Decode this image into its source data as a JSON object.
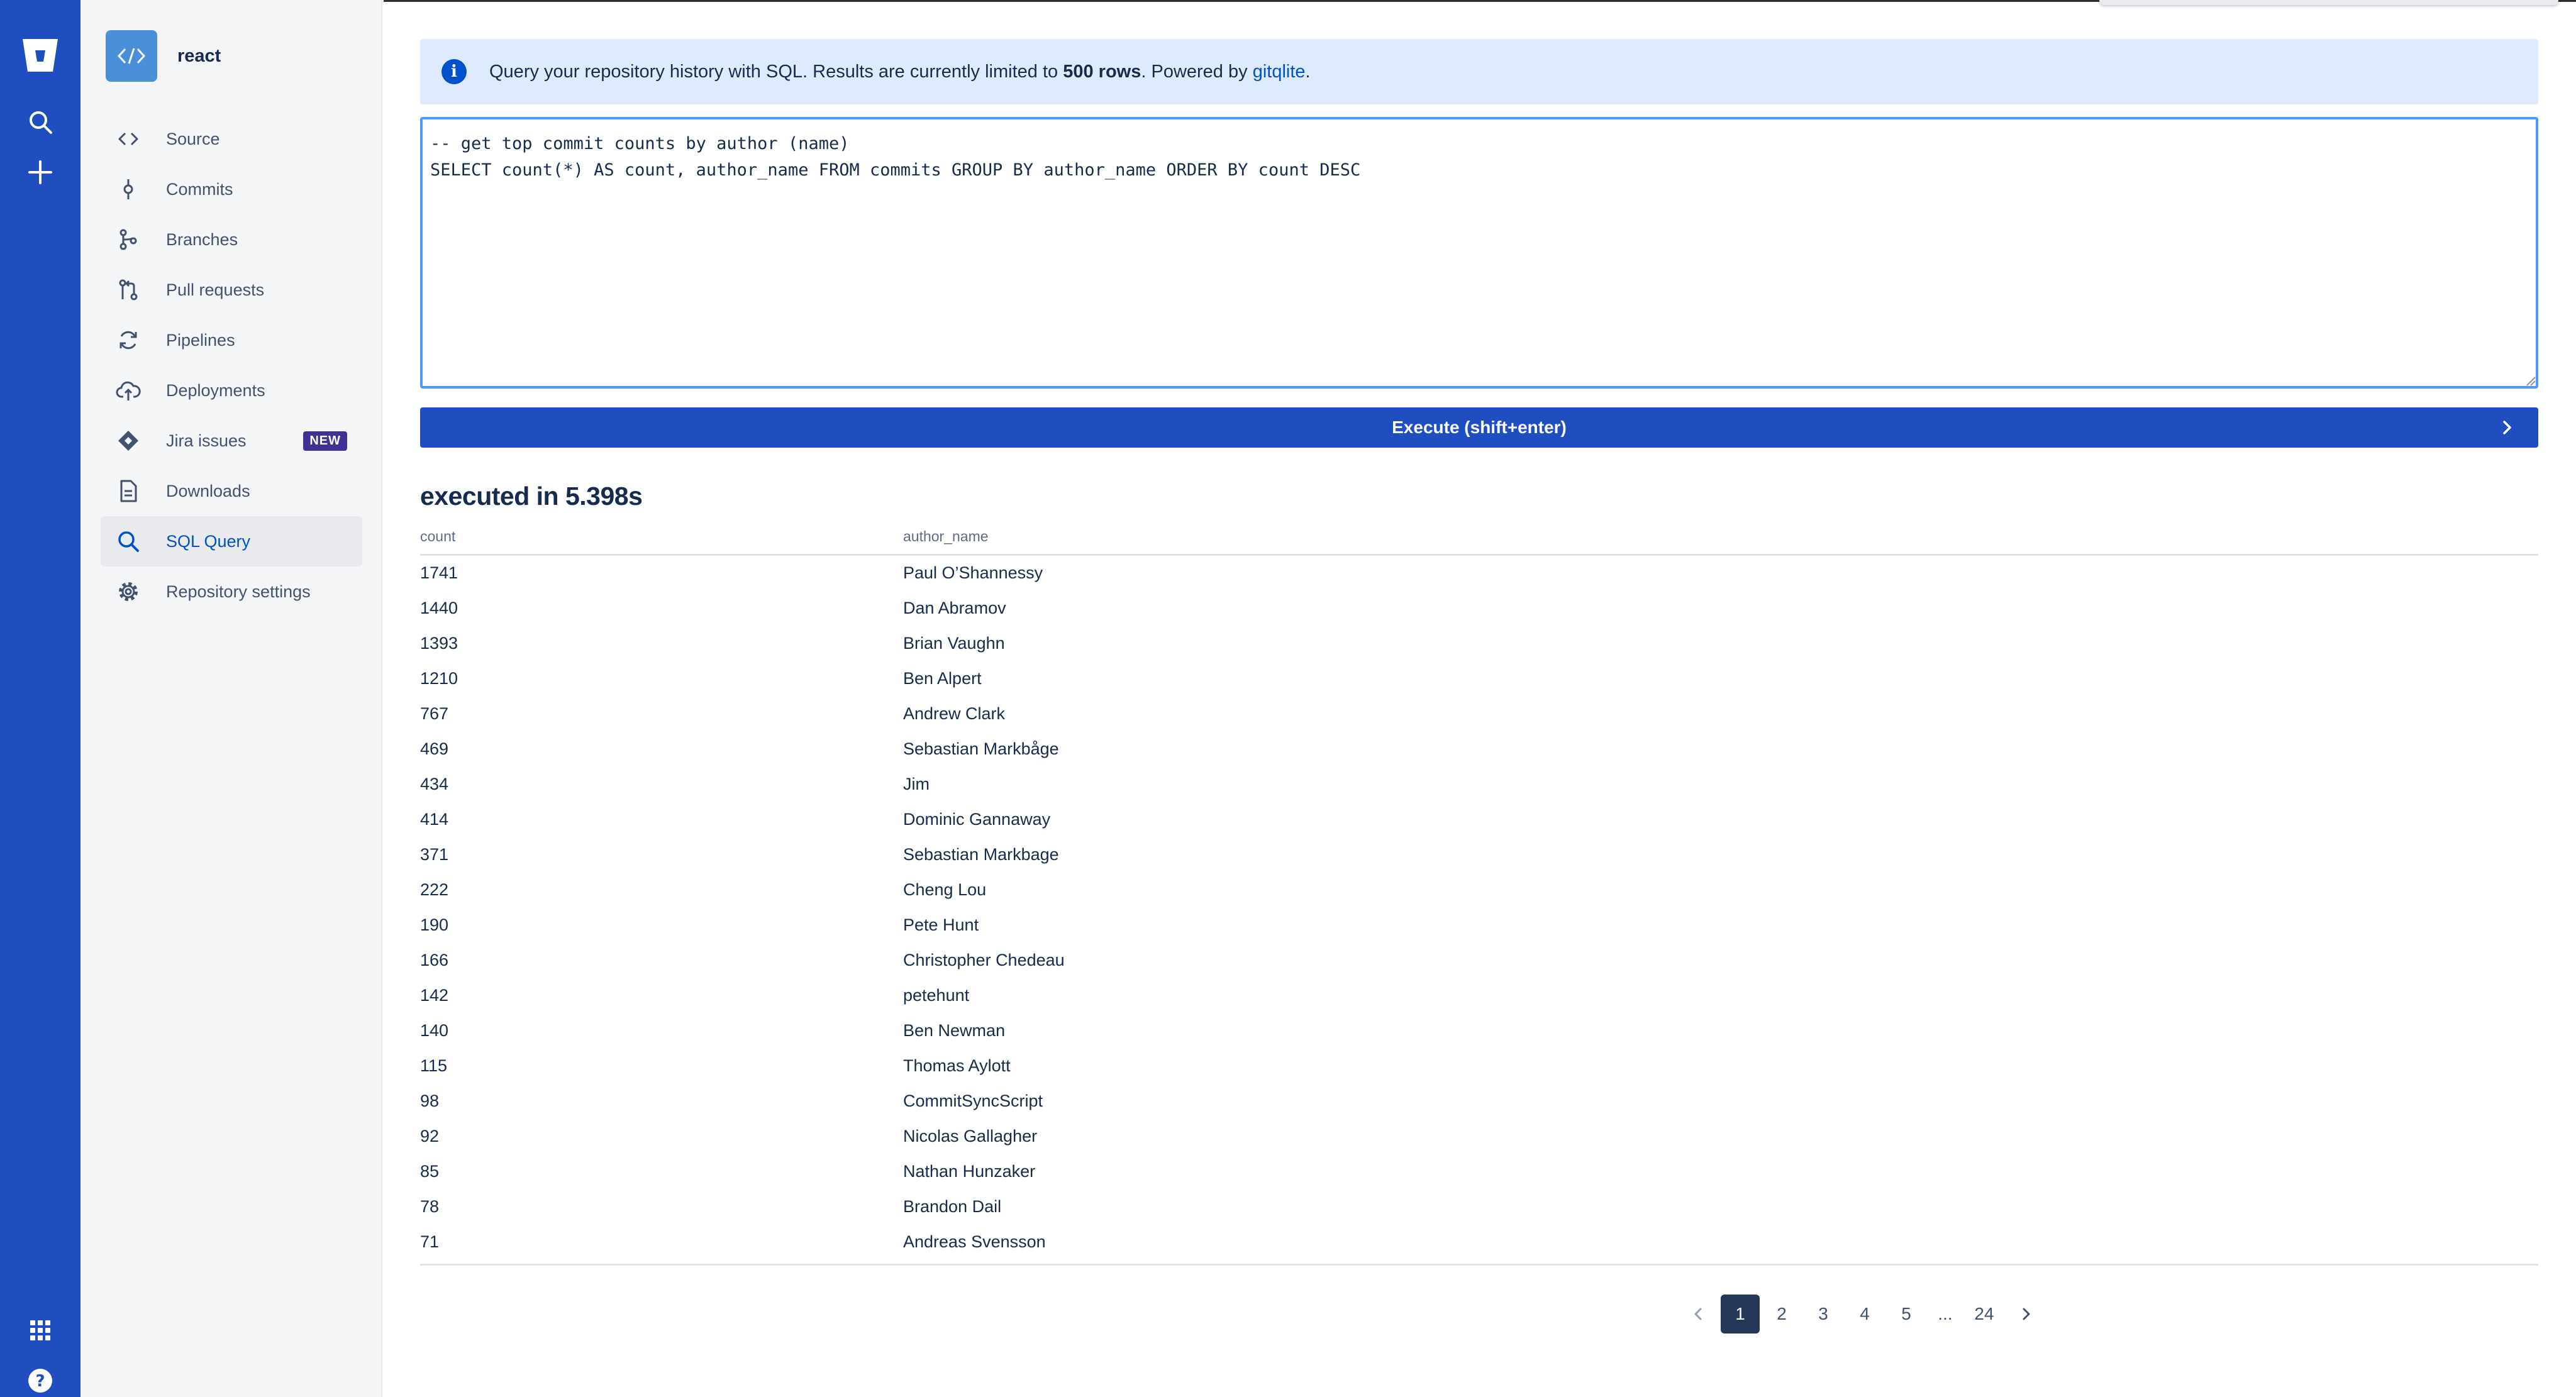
{
  "global_nav": {
    "icons": [
      "bitbucket-logo-icon",
      "search-icon",
      "create-plus-icon",
      "app-switcher-icon",
      "help-icon"
    ]
  },
  "sidebar": {
    "repo_name": "react",
    "items": [
      {
        "label": "Source",
        "icon": "code-icon",
        "active": false
      },
      {
        "label": "Commits",
        "icon": "commit-icon",
        "active": false
      },
      {
        "label": "Branches",
        "icon": "branch-icon",
        "active": false
      },
      {
        "label": "Pull requests",
        "icon": "pull-request-icon",
        "active": false
      },
      {
        "label": "Pipelines",
        "icon": "pipelines-icon",
        "active": false
      },
      {
        "label": "Deployments",
        "icon": "cloud-upload-icon",
        "active": false
      },
      {
        "label": "Jira issues",
        "icon": "jira-icon",
        "active": false,
        "badge": "NEW"
      },
      {
        "label": "Downloads",
        "icon": "document-icon",
        "active": false
      },
      {
        "label": "SQL Query",
        "icon": "search-icon",
        "active": true
      },
      {
        "label": "Repository settings",
        "icon": "gear-icon",
        "active": false
      }
    ]
  },
  "banner": {
    "text_before": "Query your repository history with SQL. Results are currently limited to ",
    "bold": "500 rows",
    "text_middle": ". Powered by ",
    "link": "gitqlite",
    "text_after": "."
  },
  "editor": {
    "value": "-- get top commit counts by author (name)\nSELECT count(*) AS count, author_name FROM commits GROUP BY author_name ORDER BY count DESC"
  },
  "execute_button": {
    "label": "Execute (shift+enter)"
  },
  "exec_time": "executed in 5.398s",
  "results": {
    "columns": [
      "count",
      "author_name"
    ],
    "rows": [
      [
        "1741",
        "Paul O’Shannessy"
      ],
      [
        "1440",
        "Dan Abramov"
      ],
      [
        "1393",
        "Brian Vaughn"
      ],
      [
        "1210",
        "Ben Alpert"
      ],
      [
        "767",
        "Andrew Clark"
      ],
      [
        "469",
        "Sebastian Markbåge"
      ],
      [
        "434",
        "Jim"
      ],
      [
        "414",
        "Dominic Gannaway"
      ],
      [
        "371",
        "Sebastian Markbage"
      ],
      [
        "222",
        "Cheng Lou"
      ],
      [
        "190",
        "Pete Hunt"
      ],
      [
        "166",
        "Christopher Chedeau"
      ],
      [
        "142",
        "petehunt"
      ],
      [
        "140",
        "Ben Newman"
      ],
      [
        "115",
        "Thomas Aylott"
      ],
      [
        "98",
        "CommitSyncScript"
      ],
      [
        "92",
        "Nicolas Gallagher"
      ],
      [
        "85",
        "Nathan Hunzaker"
      ],
      [
        "78",
        "Brandon Dail"
      ],
      [
        "71",
        "Andreas Svensson"
      ]
    ]
  },
  "pagination": {
    "pages": [
      "1",
      "2",
      "3",
      "4",
      "5",
      "...",
      "24"
    ],
    "current": "1"
  },
  "colors": {
    "global_nav": "#1E4EBF",
    "primary": "#0052CC",
    "banner_bg": "#DEEBFF",
    "badge_new": "#403294",
    "pagination_current": "#253858"
  }
}
